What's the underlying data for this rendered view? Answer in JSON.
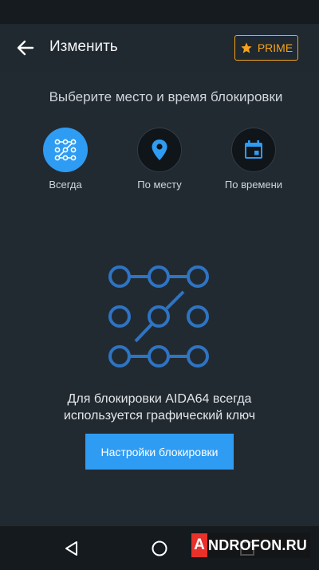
{
  "app_bar": {
    "title": "Изменить",
    "prime_label": "PRIME",
    "back_icon": "arrow-left-icon",
    "prime_icon": "star-icon"
  },
  "headline": "Выберите место и время блокировки",
  "modes": [
    {
      "label": "Всегда",
      "icon": "pattern-grid-icon",
      "selected": true
    },
    {
      "label": "По месту",
      "icon": "location-pin-icon",
      "selected": false
    },
    {
      "label": "По времени",
      "icon": "calendar-icon",
      "selected": false
    }
  ],
  "description": {
    "line1": "Для блокировки AIDA64 всегда",
    "line2": "используется графический ключ"
  },
  "lock_button_label": "Настройки блокировки",
  "watermark": {
    "letter": "A",
    "rest": "NDROFON.RU"
  },
  "colors": {
    "accent": "#2f9cf3",
    "prime": "#f5a31a",
    "background": "#222a31",
    "watermark_red": "#e8312a"
  },
  "nav": {
    "back": "back-triangle-icon",
    "home": "home-circle-icon",
    "recents": "recents-square-icon"
  }
}
